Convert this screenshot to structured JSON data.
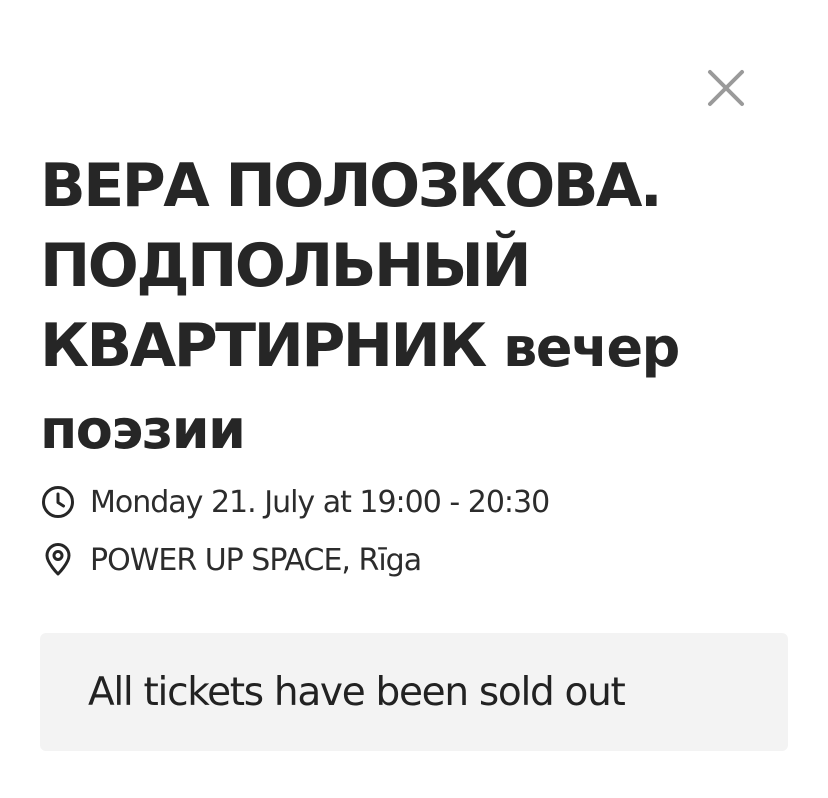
{
  "dialog": {
    "close_icon": "close-icon",
    "event": {
      "title_main": "ВЕРА ПОЛОЗКОВА. ПОДПОЛЬНЫЙ КВАРТИРНИК",
      "title_rest": "вечер поэзии",
      "datetime": "Monday 21. July at 19:00 - 20:30",
      "datetime_icon": "clock-icon",
      "venue": "POWER UP SPACE, Rīga",
      "venue_icon": "map-pin-icon"
    },
    "status": {
      "message": "All tickets have been sold out"
    }
  },
  "colors": {
    "text": "#262626",
    "close_icon": "#9a9a9a",
    "status_background": "#f3f3f3",
    "background": "#ffffff"
  }
}
